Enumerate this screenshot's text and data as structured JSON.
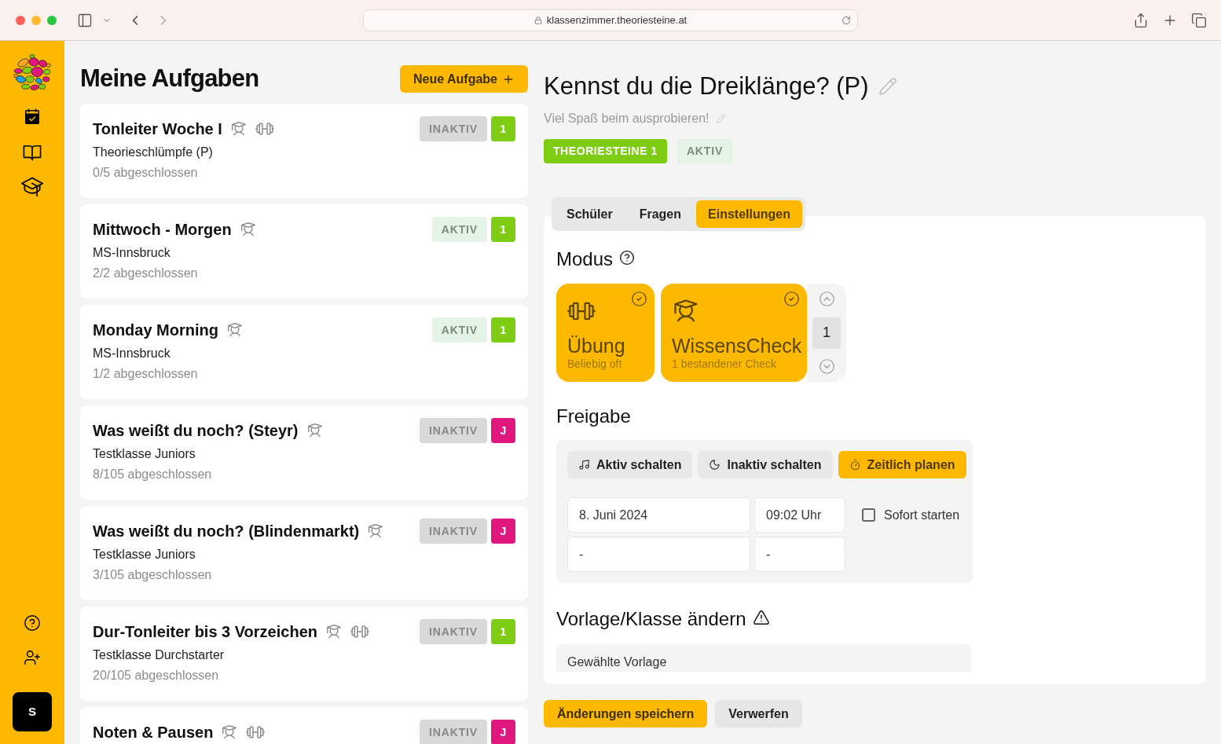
{
  "browser": {
    "url": "klassenzimmer.theoriesteine.at"
  },
  "sidebar": {
    "user_initial": "S"
  },
  "task_list": {
    "title": "Meine Aufgaben",
    "new_button": "Neue Aufgabe",
    "tasks": [
      {
        "title": "Tonleiter Woche I",
        "check": true,
        "practice": true,
        "class": "Theorieschlümpfe (P)",
        "progress": "0/5 abgeschlossen",
        "status": "INAKTIV",
        "active": false,
        "badge": "1",
        "color": "#7fcc14"
      },
      {
        "title": "Mittwoch - Morgen",
        "check": true,
        "practice": false,
        "class": "MS-Innsbruck",
        "progress": "2/2 abgeschlossen",
        "status": "AKTIV",
        "active": true,
        "badge": "1",
        "color": "#7fcc14"
      },
      {
        "title": "Monday Morning",
        "check": true,
        "practice": false,
        "class": "MS-Innsbruck",
        "progress": "1/2 abgeschlossen",
        "status": "AKTIV",
        "active": true,
        "badge": "1",
        "color": "#7fcc14"
      },
      {
        "title": "Was weißt du noch? (Steyr)",
        "check": true,
        "practice": false,
        "class": "Testklasse Juniors",
        "progress": "8/105 abgeschlossen",
        "status": "INAKTIV",
        "active": false,
        "badge": "J",
        "color": "#e0187e"
      },
      {
        "title": "Was weißt du noch? (Blindenmarkt)",
        "check": true,
        "practice": false,
        "class": "Testklasse Juniors",
        "progress": "3/105 abgeschlossen",
        "status": "INAKTIV",
        "active": false,
        "badge": "J",
        "color": "#e0187e"
      },
      {
        "title": "Dur-Tonleiter bis 3 Vorzeichen",
        "check": true,
        "practice": true,
        "class": "Testklasse Durchstarter",
        "progress": "20/105 abgeschlossen",
        "status": "INAKTIV",
        "active": false,
        "badge": "1",
        "color": "#7fcc14"
      },
      {
        "title": "Noten & Pausen",
        "check": true,
        "practice": true,
        "status": "INAKTIV",
        "active": false,
        "badge": "J",
        "color": "#e0187e"
      }
    ]
  },
  "detail": {
    "title": "Kennst du die Dreiklänge? (P)",
    "description": "Viel Spaß beim ausprobieren!",
    "class_badge": "THEORIESTEINE 1",
    "status": "AKTIV",
    "active": true,
    "tabs": [
      {
        "label": "Schüler",
        "selected": false
      },
      {
        "label": "Fragen",
        "selected": false
      },
      {
        "label": "Einstellungen",
        "selected": true
      }
    ],
    "mode": {
      "heading": "Modus",
      "options": [
        {
          "kind": "practice",
          "title": "Übung",
          "subtitle": "Beliebig oft",
          "selected": true
        },
        {
          "kind": "check",
          "title": "WissensCheck",
          "subtitle": "1 bestandener Check",
          "selected": true
        }
      ],
      "check_count": "1"
    },
    "release": {
      "heading": "Freigabe",
      "actions": [
        {
          "kind": "activate",
          "label": "Aktiv schalten",
          "selected": false
        },
        {
          "kind": "deactivate",
          "label": "Inaktiv schalten",
          "selected": false
        },
        {
          "kind": "schedule",
          "label": "Zeitlich planen",
          "selected": true
        }
      ],
      "start_date": "8. Juni 2024",
      "start_time": "09:02 Uhr",
      "end_date": "-",
      "end_time": "-",
      "immediate": {
        "label": "Sofort starten",
        "checked": false
      }
    },
    "template": {
      "heading": "Vorlage/Klasse ändern",
      "field_label": "Gewählte Vorlage"
    }
  },
  "footer": {
    "save": "Änderungen speichern",
    "discard": "Verwerfen"
  }
}
